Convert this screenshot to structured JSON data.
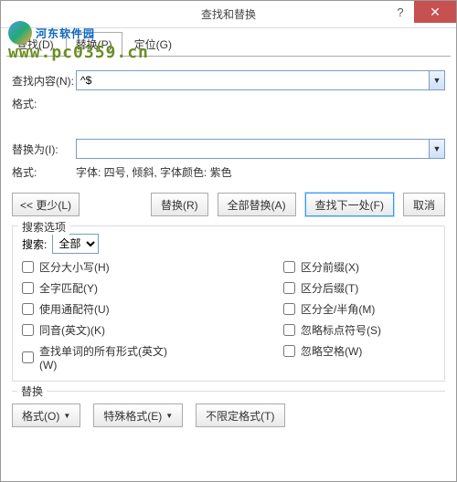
{
  "window": {
    "title": "查找和替换"
  },
  "watermark": {
    "line1": "河东软件园",
    "line2": "www.pc0359.cn"
  },
  "tabs": {
    "find": "查找(D)",
    "replace": "替换(P)",
    "goto": "定位(G)",
    "active": 1
  },
  "find": {
    "label": "查找内容(N):",
    "value": "^$"
  },
  "format_label": "格式:",
  "replace": {
    "label": "替换为(I):",
    "value": "",
    "format_desc": "字体: 四号, 倾斜, 字体颜色: 紫色"
  },
  "buttons": {
    "less": "<< 更少(L)",
    "replace": "替换(R)",
    "replace_all": "全部替换(A)",
    "find_next": "查找下一处(F)",
    "cancel": "取消"
  },
  "options": {
    "legend": "搜索选项",
    "search_label": "搜索:",
    "search_value": "全部",
    "left": [
      {
        "label": "区分大小写(H)"
      },
      {
        "label": "全字匹配(Y)"
      },
      {
        "label": "使用通配符(U)"
      },
      {
        "label": "同音(英文)(K)"
      },
      {
        "label": "查找单词的所有形式(英文)(W)"
      }
    ],
    "right": [
      {
        "label": "区分前缀(X)"
      },
      {
        "label": "区分后缀(T)"
      },
      {
        "label": "区分全/半角(M)"
      },
      {
        "label": "忽略标点符号(S)"
      },
      {
        "label": "忽略空格(W)"
      }
    ]
  },
  "replace_group": {
    "legend": "替换",
    "format": "格式(O)",
    "special": "特殊格式(E)",
    "noformat": "不限定格式(T)"
  }
}
